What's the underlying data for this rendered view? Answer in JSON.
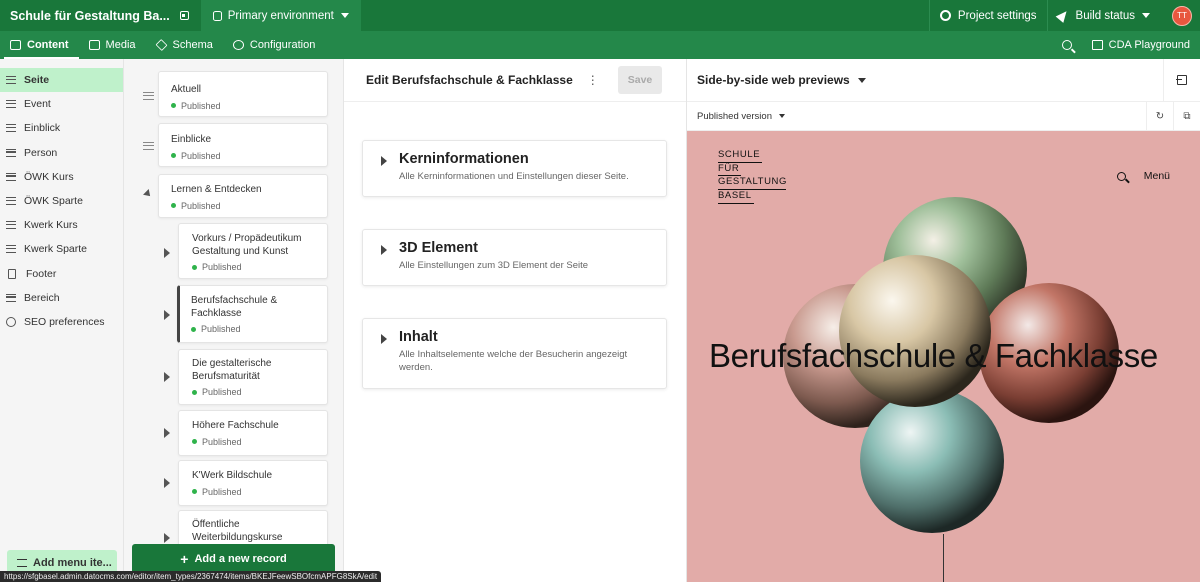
{
  "topbar": {
    "project_name": "Schule für Gestaltung Ba...",
    "environment": "Primary environment",
    "project_settings": "Project settings",
    "build_status": "Build status",
    "avatar_initials": "TT"
  },
  "nav": {
    "tabs": [
      {
        "label": "Content",
        "active": true
      },
      {
        "label": "Media"
      },
      {
        "label": "Schema"
      },
      {
        "label": "Configuration"
      }
    ],
    "cda_playground": "CDA Playground"
  },
  "models": {
    "items": [
      {
        "label": "Seite",
        "active": true
      },
      {
        "label": "Event"
      },
      {
        "label": "Einblick"
      },
      {
        "label": "Person"
      },
      {
        "label": "ÖWK Kurs"
      },
      {
        "label": "ÖWK Sparte"
      },
      {
        "label": "Kwerk Kurs"
      },
      {
        "label": "Kwerk Sparte"
      },
      {
        "label": "Footer"
      },
      {
        "label": "Bereich"
      },
      {
        "label": "SEO preferences"
      }
    ],
    "add_menu_item": "Add menu ite..."
  },
  "tree": {
    "nodes": [
      {
        "title": "Aktuell",
        "status": "Published"
      },
      {
        "title": "Einblicke",
        "status": "Published"
      },
      {
        "title": "Lernen & Entdecken",
        "status": "Published"
      },
      {
        "title": "Vorkurs / Propädeutikum Gestaltung und Kunst",
        "status": "Published"
      },
      {
        "title": "Berufsfachschule & Fachklasse",
        "status": "Published"
      },
      {
        "title": "Die gestalterische Berufsmaturität",
        "status": "Published"
      },
      {
        "title": "Höhere Fachschule",
        "status": "Published"
      },
      {
        "title": "K'Werk Bildschule",
        "status": "Published"
      },
      {
        "title": "Öffentliche Weiterbildungskurse",
        "status": ""
      }
    ],
    "add_record": "Add a new record"
  },
  "editor": {
    "title": "Edit Berufsfachschule & Fachklasse",
    "save": "Save",
    "sections": [
      {
        "title": "Kerninformationen",
        "description": "Alle Kerninformationen und Einstellungen dieser Seite."
      },
      {
        "title": "3D Element",
        "description": "Alle Einstellungen zum 3D Element der Seite"
      },
      {
        "title": "Inhalt",
        "description": "Alle Inhaltselemente welche der Besucherin angezeigt werden."
      }
    ]
  },
  "preview": {
    "title": "Side-by-side web previews",
    "version": "Published version",
    "site": {
      "logo_lines": [
        "SCHULE",
        "FÜR",
        "GESTALTUNG",
        "BASEL"
      ],
      "menu": "Menü",
      "heading": "Berufsfachschule & Fachklasse"
    }
  },
  "status_url": "https://sfgbasel.admin.datocms.com/editor/item_types/2367474/items/BKEJFeewSBOfcmAPFG8SkA/edit"
}
